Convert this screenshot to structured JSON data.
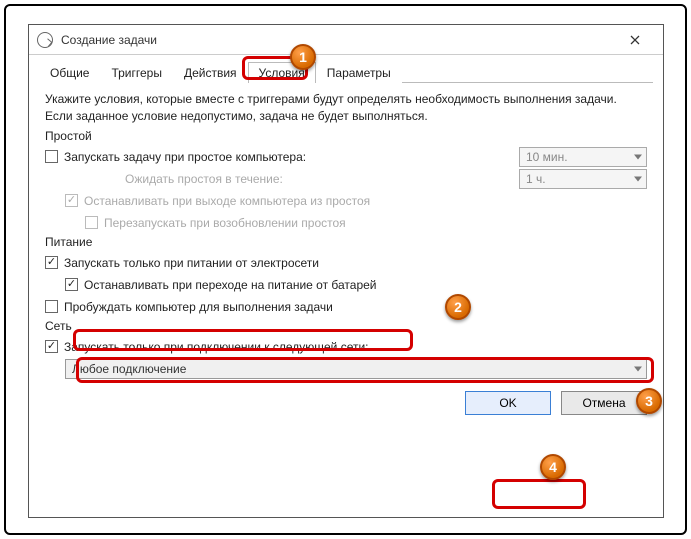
{
  "window": {
    "title": "Создание задачи"
  },
  "tabs": {
    "general": "Общие",
    "triggers": "Триггеры",
    "actions": "Действия",
    "conditions": "Условия",
    "settings": "Параметры"
  },
  "description": "Укажите условия, которые вместе с триггерами будут определять необходимость выполнения задачи. Если заданное условие недопустимо, задача не будет выполняться.",
  "sections": {
    "idle": "Простой",
    "power": "Питание",
    "network": "Сеть"
  },
  "idle": {
    "start_when_idle": "Запускать задачу при простое компьютера:",
    "wait_for_idle": "Ожидать простоя в течение:",
    "stop_if_not_idle": "Останавливать при выходе компьютера из простоя",
    "restart_on_idle": "Перезапускать при возобновлении простоя",
    "idle_time": "10 мин.",
    "wait_time": "1 ч."
  },
  "power": {
    "ac_only": "Запускать только при питании от электросети",
    "stop_on_battery": "Останавливать при переходе на питание от батарей",
    "wake": "Пробуждать компьютер для выполнения задачи"
  },
  "network": {
    "start_on_network": "Запускать только при подключении к следующей сети:",
    "selected": "Любое подключение"
  },
  "buttons": {
    "ok": "OK",
    "cancel": "Отмена"
  },
  "callouts": {
    "c1": "1",
    "c2": "2",
    "c3": "3",
    "c4": "4"
  }
}
